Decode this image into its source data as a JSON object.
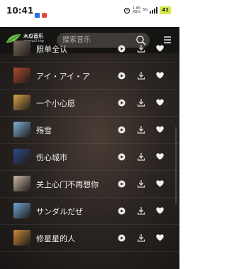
{
  "status_bar": {
    "time": "10:41",
    "net_speed": "1.80",
    "net_unit": "KB/s",
    "net_type": "5G",
    "battery": "41"
  },
  "header": {
    "logo_title": "木瓜音乐",
    "logo_subtitle": "mgmp3.top",
    "search_placeholder": "搜索音乐",
    "search_icon": "search-icon",
    "menu_icon": "hamburger-menu-icon"
  },
  "songs": [
    {
      "title": "照单全认",
      "thumb_color": "#7a6d5e"
    },
    {
      "title": "アイ・アイ・ア",
      "thumb_color": "#b04a2c"
    },
    {
      "title": "一个小心愿",
      "thumb_color": "#d8a24a"
    },
    {
      "title": "殇雪",
      "thumb_color": "#7fb4d8"
    },
    {
      "title": "伤心城市",
      "thumb_color": "#2f4a8a"
    },
    {
      "title": "关上心门不再想你",
      "thumb_color": "#c9b9a6"
    },
    {
      "title": "サンダルだぜ",
      "thumb_color": "#6fa9d6"
    },
    {
      "title": "修星星的人",
      "thumb_color": "#c98a3a"
    }
  ],
  "row_actions": {
    "play_icon": "play-icon",
    "download_icon": "download-icon",
    "favorite_icon": "heart-icon"
  },
  "colors": {
    "background": "#2b2522",
    "header": "#141312",
    "search_bg": "#3f3b39",
    "logo_green": "#6cc04a",
    "text": "#f1f1f1"
  }
}
